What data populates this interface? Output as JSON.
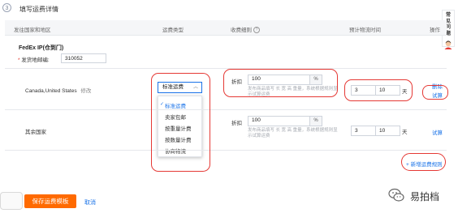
{
  "step": {
    "number": "3",
    "title": "填写运费详情"
  },
  "table_headers": {
    "region": "发往国家和地区",
    "shipping_type": "运费类型",
    "fee_detail": "收费细则",
    "delivery_time": "预计物流时间",
    "action": "操作"
  },
  "carrier": {
    "name": "FedEx IP(仓到门)"
  },
  "origin_zip": {
    "label": "发货地邮编:",
    "required_mark": "*",
    "value": "310052"
  },
  "rows": [
    {
      "countries": "Canada,United States",
      "edit_label": "修改",
      "shipping_type_selected": "标准运费",
      "discount_label": "折扣",
      "discount_value": "100",
      "discount_unit": "%",
      "hint": "发布商品填写 长 宽 高 重量，系统根据规则显示试算运费",
      "time_from": "3",
      "time_sep": "-",
      "time_to": "10",
      "time_unit": "天",
      "action_delete": "删除",
      "action_trial": "试算"
    },
    {
      "countries": "其余国家",
      "discount_label": "折扣",
      "discount_value": "100",
      "discount_unit": "%",
      "hint": "发布商品填写 长 宽 高 重量，系统根据规则显示试算运费",
      "time_from": "3",
      "time_sep": "-",
      "time_to": "10",
      "time_unit": "天",
      "action_trial": "试算"
    }
  ],
  "dropdown": {
    "options": [
      "标准运费",
      "卖家包邮",
      "按重量计费",
      "按数量计费",
      "协商物流"
    ],
    "selected_index": 0
  },
  "add_rule": {
    "label": "+ 新增运费规则"
  },
  "side_help": {
    "text": "常见问题"
  },
  "bottom": {
    "save_label": "保存运费模板",
    "cancel_label": "取消"
  },
  "watermark": {
    "text": "易拍档"
  },
  "colors": {
    "accent": "#1a73e8",
    "highlight_oval": "#e53935",
    "primary_button": "#ff6a00"
  }
}
